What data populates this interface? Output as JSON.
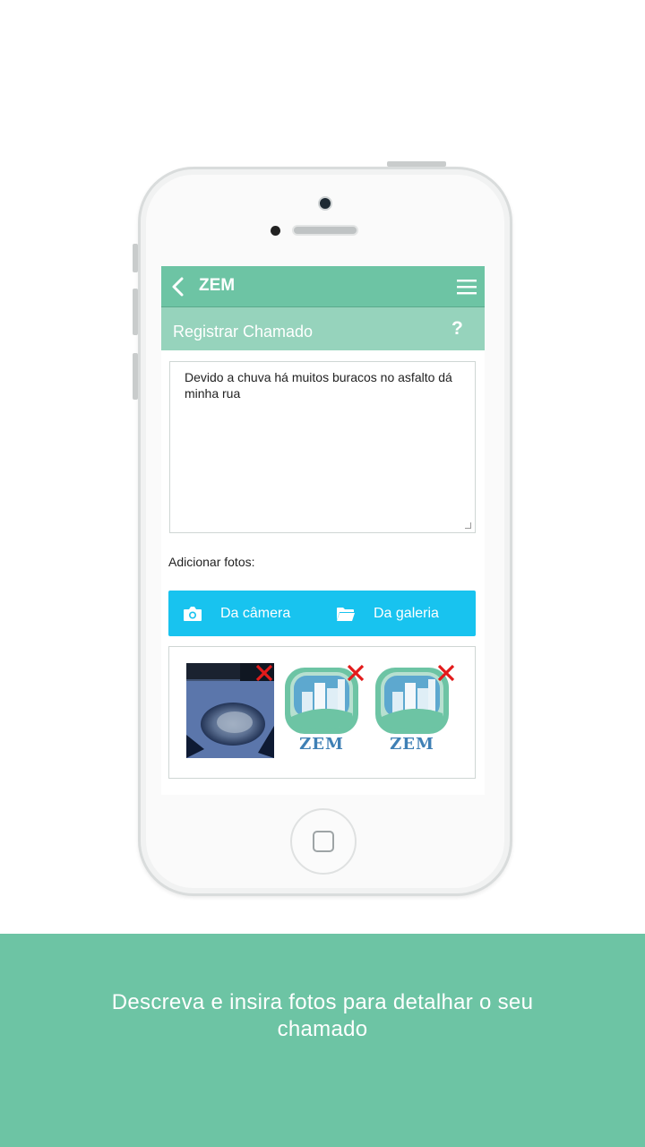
{
  "app": {
    "title": "ZEM",
    "subtitle": "Registrar Chamado",
    "help_label": "?"
  },
  "form": {
    "description_value": "Devido a chuva há muitos buracos no asfalto dá minha rua",
    "add_photos_label": "Adicionar fotos:",
    "camera_button": "Da câmera",
    "gallery_button": "Da galeria"
  },
  "photos": [
    {
      "kind": "pothole-photo"
    },
    {
      "kind": "zem-logo",
      "logo_text": "ZEM"
    },
    {
      "kind": "zem-logo",
      "logo_text": "ZEM"
    }
  ],
  "footer": {
    "caption": "Descreva e insira fotos para detalhar o seu chamado"
  },
  "colors": {
    "primary": "#6dc4a4",
    "secondary": "#96d3bc",
    "action": "#18c3ef",
    "remove": "#e31b1b"
  }
}
